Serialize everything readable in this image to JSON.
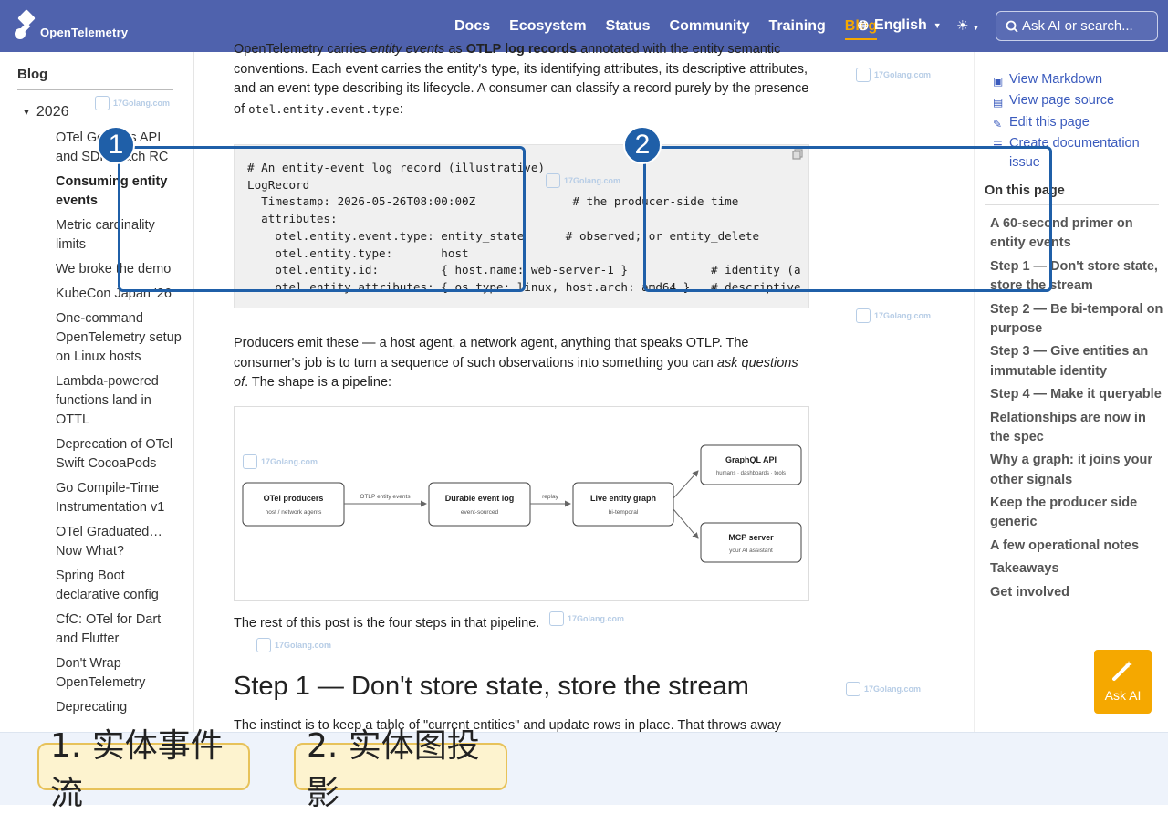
{
  "navbar": {
    "logo_text": "OpenTelemetry",
    "items": [
      "Docs",
      "Ecosystem",
      "Status",
      "Community",
      "Training",
      "Blog"
    ],
    "active": "Blog",
    "language": "English",
    "search_placeholder": "Ask AI or search..."
  },
  "left_sidebar": {
    "heading": "Blog",
    "year": "2026",
    "posts": [
      "OTel Go Logs API and SDK reach RC",
      "Consuming entity events",
      "Metric cardinality limits",
      "We broke the demo",
      "KubeCon Japan '26",
      "One-command OpenTelemetry setup on Linux hosts",
      "Lambda-powered functions land in OTTL",
      "Deprecation of OTel Swift CocoaPods",
      "Go Compile-Time Instrumentation v1",
      "OTel Graduated… Now What?",
      "Spring Boot declarative config",
      "CfC: OTel for Dart and Flutter",
      "Don't Wrap OpenTelemetry",
      "Deprecating"
    ],
    "active_post": "Consuming entity events"
  },
  "main": {
    "intro_line1_a": "OpenTelemetry carries ",
    "intro_line1_em": "entity events",
    "intro_line1_b": " as ",
    "intro_line1_strong": "OTLP log records",
    "intro_line1_c": " annotated with the entity semantic",
    "intro_rest": "conventions. Each event carries the entity's type, its identifying attributes, its descriptive attributes, and an event type describing its lifecycle. A consumer can classify a record purely by the presence of ",
    "intro_code": "otel.entity.event.type",
    "intro_end": ":",
    "code": "# An entity-event log record (illustrative)\nLogRecord\n  Timestamp: 2026-05-26T08:00:00Z              # the producer-side time\n  attributes:\n    otel.entity.event.type: entity_state      # observed; or entity_delete\n    otel.entity.type:       host\n    otel.entity.id:         { host.name: web-server-1 }            # identity (a m\n    otel.entity.attributes: { os.type: linux, host.arch: amd64 }   # descriptive (",
    "para2_a": "Producers emit these — a host agent, a network agent, anything that speaks OTLP. The consumer's job is to turn a sequence of such observations into something you can ",
    "para2_em": "ask questions of",
    "para2_b": ". The shape is a pipeline:",
    "para3": "The rest of this post is the four steps in that pipeline.",
    "h2": "Step 1 — Don't store state, store the stream",
    "para4": "The instinct is to keep a table of \"current entities\" and update rows in place. That throws away"
  },
  "diagram": {
    "producers_title": "OTel producers",
    "producers_sub": "host / network agents",
    "edge1": "OTLP entity events",
    "log_title": "Durable event log",
    "log_sub": "event-sourced",
    "edge2": "replay",
    "graph_title": "Live entity graph",
    "graph_sub": "bi-temporal",
    "gql_title": "GraphQL API",
    "gql_sub": "humans · dashboards · tools",
    "mcp_title": "MCP server",
    "mcp_sub": "your AI assistant"
  },
  "right_sidebar": {
    "page_links": [
      "View Markdown",
      "View page source",
      "Edit this page",
      "Create documentation issue"
    ],
    "toc_heading": "On this page",
    "toc": [
      "A 60-second primer on entity events",
      "Step 1 — Don't store state, store the stream",
      "Step 2 — Be bi-temporal on purpose",
      "Step 3 — Give entities an immutable identity",
      "Step 4 — Make it queryable",
      "Relationships are now in the spec",
      "Why a graph: it joins your other signals",
      "Keep the producer side generic",
      "A few operational notes",
      "Takeaways",
      "Get involved"
    ]
  },
  "ask_ai": "Ask AI",
  "watermark": "17Golang.com",
  "annotations": {
    "badge1": "1",
    "badge2": "2",
    "caption1": "1. 实体事件流",
    "caption2": "2. 实体图投影"
  },
  "colors": {
    "navbar": "#4f62ad",
    "accent": "#f5a800",
    "annotation": "#1f5fa8"
  }
}
